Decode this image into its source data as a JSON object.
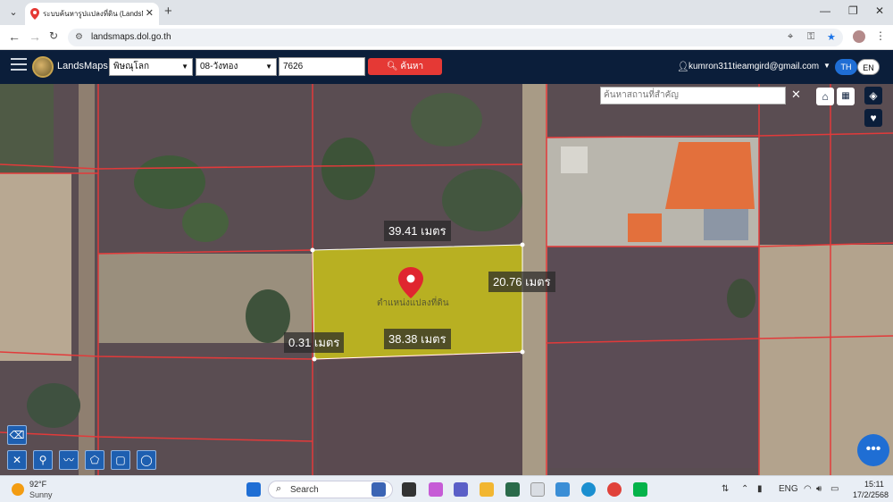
{
  "browser": {
    "tab_title": "ระบบค้นหารูปแปลงที่ดิน (LandsMaps)",
    "url": "landsmaps.dol.go.th"
  },
  "app": {
    "brand": "LandsMaps",
    "province": "พิษณุโลก",
    "district": "08-วังทอง",
    "parcel_no": "7626",
    "search_label": "ค้นหา",
    "user_email": "kumron311tieamgird@gmail.com",
    "lang_th": "TH",
    "lang_en": "EN"
  },
  "map": {
    "place_search_placeholder": "ค้นหาสถานที่สำคัญ",
    "marker_label": "ตำแหน่งแปลงที่ดิน",
    "dimensions": {
      "top": "39.41 เมตร",
      "right": "20.76 เมตร",
      "bottom": "38.38 เมตร",
      "left": "0.31 เมตร"
    },
    "colors": {
      "parcel_fill": "#c9c21a",
      "boundary": "#e23a3a"
    }
  },
  "taskbar": {
    "temperature": "92°F",
    "condition": "Sunny",
    "search_label": "Search",
    "language": "ENG",
    "time": "15:11",
    "date": "17/2/2568"
  }
}
